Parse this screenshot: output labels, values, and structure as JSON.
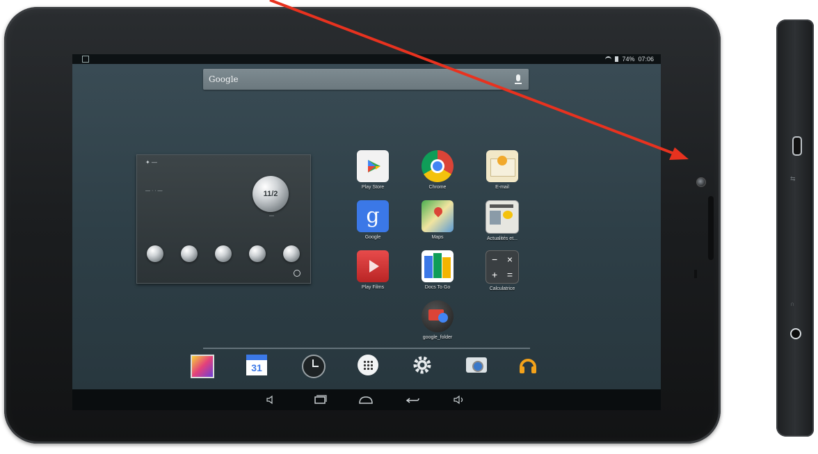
{
  "status": {
    "battery": "74%",
    "time": "07:06"
  },
  "search": {
    "label": "Google"
  },
  "widget": {
    "date": "11/2"
  },
  "apps": [
    {
      "name": "play-store",
      "label": "Play Store"
    },
    {
      "name": "chrome",
      "label": "Chrome"
    },
    {
      "name": "email",
      "label": "E-mail"
    },
    {
      "name": "google",
      "label": "Google"
    },
    {
      "name": "maps",
      "label": "Maps"
    },
    {
      "name": "news",
      "label": "Actualités et..."
    },
    {
      "name": "play-films",
      "label": "Play Films"
    },
    {
      "name": "docs-to-go",
      "label": "Docs To Go"
    },
    {
      "name": "calculator",
      "label": "Calculatrice"
    },
    {
      "name": "google-folder",
      "label": "google_folder"
    }
  ],
  "dock": {
    "calendar_day": "31",
    "items": [
      "gallery",
      "calendar",
      "clock",
      "app-drawer",
      "settings",
      "camera",
      "music"
    ]
  },
  "colors": {
    "arrow": "#e8321f",
    "wallpaper": "#2e3f47"
  }
}
